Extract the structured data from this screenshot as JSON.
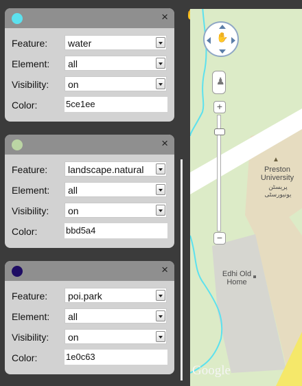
{
  "panels": [
    {
      "swatch_color": "#5ce1ee",
      "labels": {
        "feature": "Feature:",
        "element": "Element:",
        "visibility": "Visibility:",
        "color": "Color:"
      },
      "feature": "water",
      "element": "all",
      "visibility": "on",
      "color": "5ce1ee"
    },
    {
      "swatch_color": "#bbd5a4",
      "labels": {
        "feature": "Feature:",
        "element": "Element:",
        "visibility": "Visibility:",
        "color": "Color:"
      },
      "feature": "landscape.natural",
      "element": "all",
      "visibility": "on",
      "color": "bbd5a4"
    },
    {
      "swatch_color": "#1e0c63",
      "labels": {
        "feature": "Feature:",
        "element": "Element:",
        "visibility": "Visibility:",
        "color": "Color:"
      },
      "feature": "poi.park",
      "element": "all",
      "visibility": "on",
      "color": "1e0c63"
    }
  ],
  "close_symbol": "×",
  "map": {
    "places": {
      "university_name": "Preston University",
      "university_local": "پریسٹن یونیورسٹی",
      "home_name": "Edhi Old Home"
    },
    "logo": "Google",
    "zoom_plus": "+",
    "zoom_minus": "−",
    "colors": {
      "water": "#5ce1ee",
      "landscape": "#bbd5a4",
      "road": "#ffffff",
      "building": "#e6dcc0",
      "block": "#d6d6d0",
      "highway": "#f5e86a"
    }
  },
  "icons": {
    "pan": "pan-hand-icon",
    "pegman": "pegman-icon",
    "cursor": "hand-cursor-icon",
    "school": "school-icon",
    "point": "point-icon"
  }
}
